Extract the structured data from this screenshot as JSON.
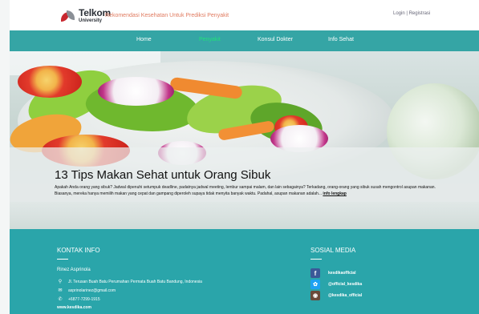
{
  "header": {
    "brand": "Telkom",
    "brand_sub": "University",
    "tagline": "Rekomendasi Kesehatan Untuk Prediksi Penyakit",
    "login": "Login",
    "separator": "|",
    "register": "Registrasi"
  },
  "nav": {
    "items": [
      {
        "label": "Home",
        "active": false
      },
      {
        "label": "Penyakit",
        "active": true
      },
      {
        "label": "Konsul Dokter",
        "active": false
      },
      {
        "label": "Info Sehat",
        "active": false
      }
    ],
    "active_color": "#22e07a"
  },
  "hero": {
    "title": "13 Tips Makan Sehat untuk Orang Sibuk",
    "description": "Apakah Anda orang yang sibuk? Jadwal dipenuhi setumpuk deadline, padatnya jadwal meeting, lembur sampai malam, dan lain sebagainya? Terkadang, orang-orang yang sibuk susah mengontrol asupan makanan. Biasanya, mereka hanya memilih makan yang cepat dan gampang diperoleh supaya tidak menyita banyak waktu. Padahal, asupan makanan adalah...",
    "read_more": "info lengkap"
  },
  "footer": {
    "contact": {
      "heading": "KONTAK INFO",
      "name": "Rinez Asprinola",
      "address": "Jl. Terusan Buah Batu Perumahan Permata Buah Batu Bandung, Indonesia",
      "email": "asprinolarinez@gmail.com",
      "phone": "+6877-7299-1915",
      "website": "www.kesdika.com"
    },
    "social": {
      "heading": "SOSIAL MEDIA",
      "facebook": "kesdikaofficial",
      "twitter": "@official_kesdika",
      "instagram": "@kesdika_official"
    }
  },
  "colors": {
    "nav_bg": "#35a5a5",
    "footer_bg": "#2aa5aa",
    "tagline": "#e07a5f",
    "facebook": "#3b5998",
    "twitter": "#1da1f2",
    "instagram": "#6b4a3a"
  }
}
